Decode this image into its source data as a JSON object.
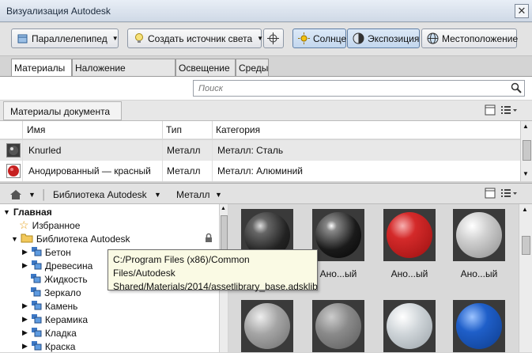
{
  "window": {
    "title": "Визуализация Autodesk",
    "close": "✕"
  },
  "toolbar": {
    "box": "Параллелепипед",
    "create_light": "Создать источник света",
    "sun": "Солнце",
    "exposure": "Экспозиция",
    "location": "Местоположение"
  },
  "tabs": [
    "Материалы",
    "Наложение материала",
    "Освещение",
    "Среды"
  ],
  "search": {
    "placeholder": "Поиск"
  },
  "doc_materials": {
    "label": "Материалы документа"
  },
  "table": {
    "headers": {
      "name": "Имя",
      "type": "Тип",
      "category": "Категория"
    },
    "rows": [
      {
        "name": "Knurled",
        "type": "Металл",
        "category": "Металл: Сталь"
      },
      {
        "name": "Анодированный — красный",
        "type": "Металл",
        "category": "Металл: Алюминий"
      }
    ]
  },
  "library": {
    "crumb1": "Библиотека Autodesk",
    "crumb2": "Металл"
  },
  "tree": {
    "root": "Главная",
    "favorites": "Избранное",
    "library": "Библиотека Autodesk",
    "items": [
      "Бетон",
      "Древесина",
      "Жидкость",
      "Зеркало",
      "Камень",
      "Керамика",
      "Кладка",
      "Краска"
    ]
  },
  "thumbs": {
    "labels": [
      "",
      "Ано...ый",
      "Ано...ый",
      "Ано...ый"
    ]
  },
  "tooltip": {
    "line1": "C:/Program Files (x86)/Common Files/Autodesk",
    "line2": "Shared/Materials/2014/assetlibrary_base.adsklib"
  },
  "colors": {
    "accent": "#c3d7ee",
    "title_bg": "#cfd9e6"
  }
}
